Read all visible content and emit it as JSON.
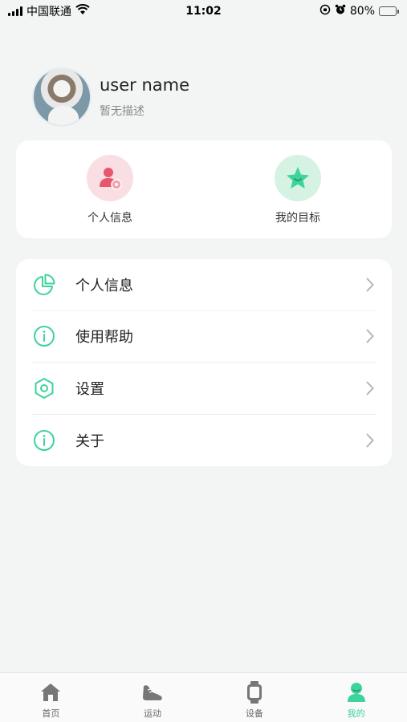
{
  "status_bar": {
    "carrier": "中国联通",
    "time": "11:02",
    "battery": "80%",
    "battery_level": 0.8
  },
  "profile": {
    "user_name": "user name",
    "description": "暂无描述"
  },
  "quick_actions": [
    {
      "label": "个人信息",
      "icon": "user-settings-icon",
      "color": "#f9dfe3"
    },
    {
      "label": "我的目标",
      "icon": "star-icon",
      "color": "#d6f2e3"
    }
  ],
  "menu": [
    {
      "label": "个人信息",
      "icon": "pie-chart-icon"
    },
    {
      "label": "使用帮助",
      "icon": "info-icon"
    },
    {
      "label": "设置",
      "icon": "hexagon-settings-icon"
    },
    {
      "label": "关于",
      "icon": "info-icon"
    }
  ],
  "tabs": [
    {
      "label": "首页",
      "icon": "home-icon",
      "active": false
    },
    {
      "label": "运动",
      "icon": "shoe-icon",
      "active": false
    },
    {
      "label": "设备",
      "icon": "watch-icon",
      "active": false
    },
    {
      "label": "我的",
      "icon": "person-icon",
      "active": true
    }
  ],
  "colors": {
    "accent": "#3ed39b",
    "background": "#f2f5f4",
    "card": "#ffffff"
  }
}
